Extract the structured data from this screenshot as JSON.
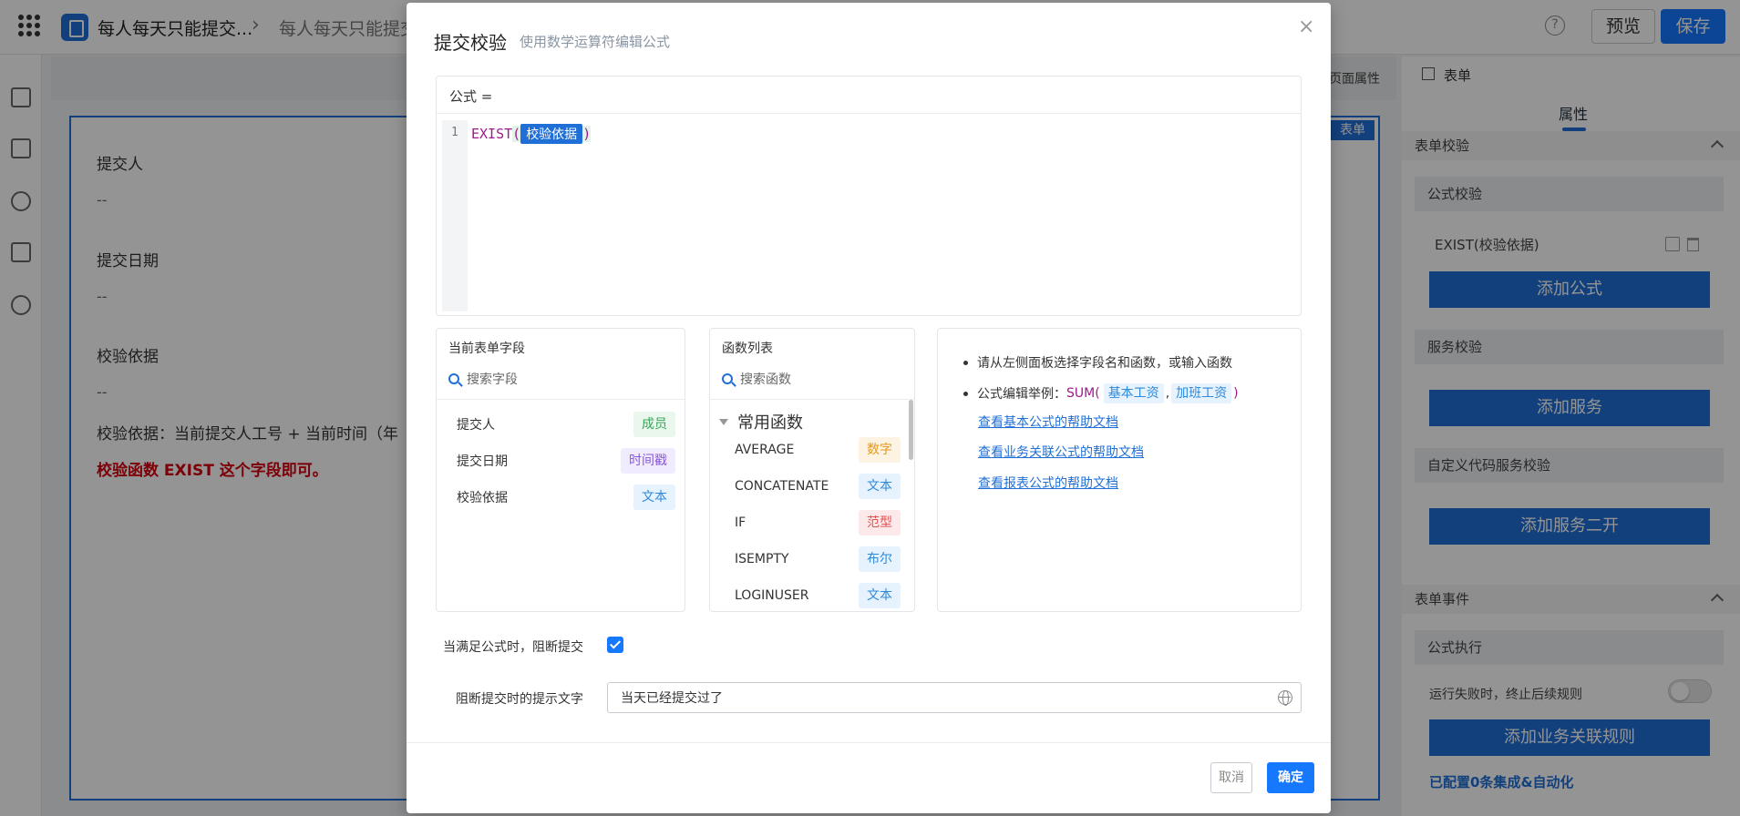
{
  "header": {
    "breadcrumb_1": "每人每天只能提交...",
    "breadcrumb_sep": "›",
    "breadcrumb_2": "每人每天只能提交",
    "help": "?",
    "preview_label": "预览",
    "save_label": "保存"
  },
  "canvas": {
    "page_props_label": "页面属性",
    "form_tag": "表单",
    "fields": [
      {
        "label": "提交人",
        "value": "--"
      },
      {
        "label": "提交日期",
        "value": "--"
      },
      {
        "label": "校验依据",
        "value": "--"
      }
    ],
    "note": "校验依据：当前提交人工号 + 当前时间（年",
    "warning": "校验函数 EXIST 这个字段即可。"
  },
  "right_panel": {
    "header": "表单",
    "tab": "属性",
    "section_validation": "表单校验",
    "formula_group": "公式校验",
    "formula_item": "EXIST(校验依据)",
    "add_formula": "添加公式",
    "service_group": "服务校验",
    "add_service": "添加服务",
    "custom_group": "自定义代码服务校验",
    "add_custom": "添加服务二开",
    "section_events": "表单事件",
    "exec_group": "公式执行",
    "stop_on_fail": "运行失败时，终止后续规则",
    "add_rule": "添加业务关联规则",
    "configured": "已配置0条集成&自动化"
  },
  "dialog": {
    "title": "提交校验",
    "subtitle": "使用数学运算符编辑公式",
    "close": "×",
    "formula_label": "公式 =",
    "line_number": "1",
    "code_fn": "EXIST",
    "code_open": "(",
    "code_field": "校验依据",
    "code_close": ")",
    "fields_panel": {
      "title": "当前表单字段",
      "search_placeholder": "搜索字段",
      "items": [
        {
          "name": "提交人",
          "type": "成员"
        },
        {
          "name": "提交日期",
          "type": "时间戳"
        },
        {
          "name": "校验依据",
          "type": "文本"
        }
      ]
    },
    "functions_panel": {
      "title": "函数列表",
      "search_placeholder": "搜索函数",
      "group": "常用函数",
      "items": [
        {
          "name": "AVERAGE",
          "type": "数字"
        },
        {
          "name": "CONCATENATE",
          "type": "文本"
        },
        {
          "name": "IF",
          "type": "范型"
        },
        {
          "name": "ISEMPTY",
          "type": "布尔"
        },
        {
          "name": "LOGINUSER",
          "type": "文本"
        }
      ]
    },
    "help": {
      "tip1": "请从左侧面板选择字段名和函数，或输入函数",
      "tip2_prefix": "公式编辑举例：",
      "tip2_fn": "SUM(",
      "tip2_arg1": "基本工资",
      "tip2_comma": ",",
      "tip2_arg2": "加班工资",
      "tip2_close": ")",
      "link1": "查看基本公式的帮助文档",
      "link2": "查看业务关联公式的帮助文档",
      "link3": "查看报表公式的帮助文档"
    },
    "block_label": "当满足公式时，阻断提交",
    "tip_label": "阻断提交时的提示文字",
    "tip_value": "当天已经提交过了",
    "cancel_label": "取消",
    "ok_label": "确定"
  }
}
